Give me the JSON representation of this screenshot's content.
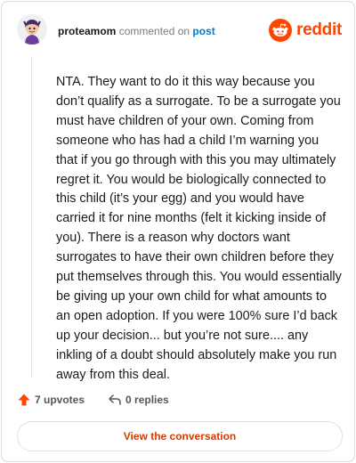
{
  "comment": {
    "username": "proteamom",
    "commented_text": "commented on",
    "post_link": "post",
    "body": "NTA. They want to do it this way because you don’t qualify as a surrogate. To be a surrogate you must have children of your own. Coming from someone who has had a child I’m warning you that if you go through with this you may ultimately regret it. You would be biologically connected to this child (it’s your egg) and you would have carried it for nine months (felt it kicking inside of you). There is a reason why doctors want surrogates to have their own children before they put themselves through this. You would essentially be giving up your own child for what amounts to an open adoption. If you were 100% sure I’d back up your decision... but you’re not sure.... any inkling of a doubt should absolutely make you run away from this deal."
  },
  "brand": {
    "wordmark": "reddit",
    "accent_color": "#ff4500"
  },
  "actions": {
    "upvotes": "7 upvotes",
    "replies": "0 replies"
  },
  "footer": {
    "view_label": "View the conversation"
  },
  "icons": {
    "avatar": "avatar",
    "logo": "reddit-logo-icon",
    "upvote": "upvote-arrow-icon",
    "reply": "reply-arrow-icon"
  }
}
